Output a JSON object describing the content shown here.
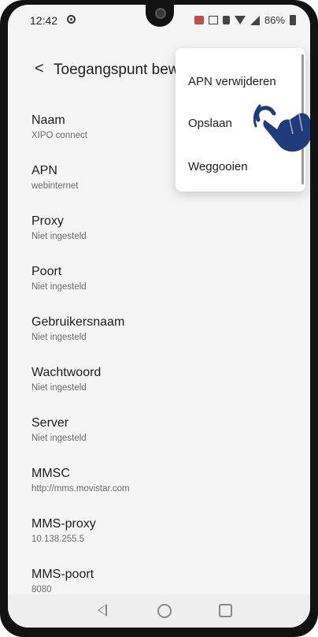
{
  "status_bar": {
    "time": "12:42",
    "battery": "86%"
  },
  "app_bar": {
    "back_icon": "back-chevron-icon",
    "title": "Toegangspunt bewe"
  },
  "overflow_menu": {
    "items": [
      {
        "label": "APN verwijderen"
      },
      {
        "label": "Opslaan"
      },
      {
        "label": "Weggooien"
      }
    ]
  },
  "settings": [
    {
      "title": "Naam",
      "value": "XIPO connect"
    },
    {
      "title": "APN",
      "value": "webinternet"
    },
    {
      "title": "Proxy",
      "value": "Niet ingesteld"
    },
    {
      "title": "Poort",
      "value": "Niet ingesteld"
    },
    {
      "title": "Gebruikersnaam",
      "value": "Niet ingesteld"
    },
    {
      "title": "Wachtwoord",
      "value": "Niet ingesteld"
    },
    {
      "title": "Server",
      "value": "Niet ingesteld"
    },
    {
      "title": "MMSC",
      "value": "http://mms.movistar.com"
    },
    {
      "title": "MMS-proxy",
      "value": "10.138.255.5"
    },
    {
      "title": "MMS-poort",
      "value": "8080"
    }
  ],
  "colors": {
    "screen_bg": "#f5f5f6",
    "hand_accent": "#1f3b7a"
  }
}
